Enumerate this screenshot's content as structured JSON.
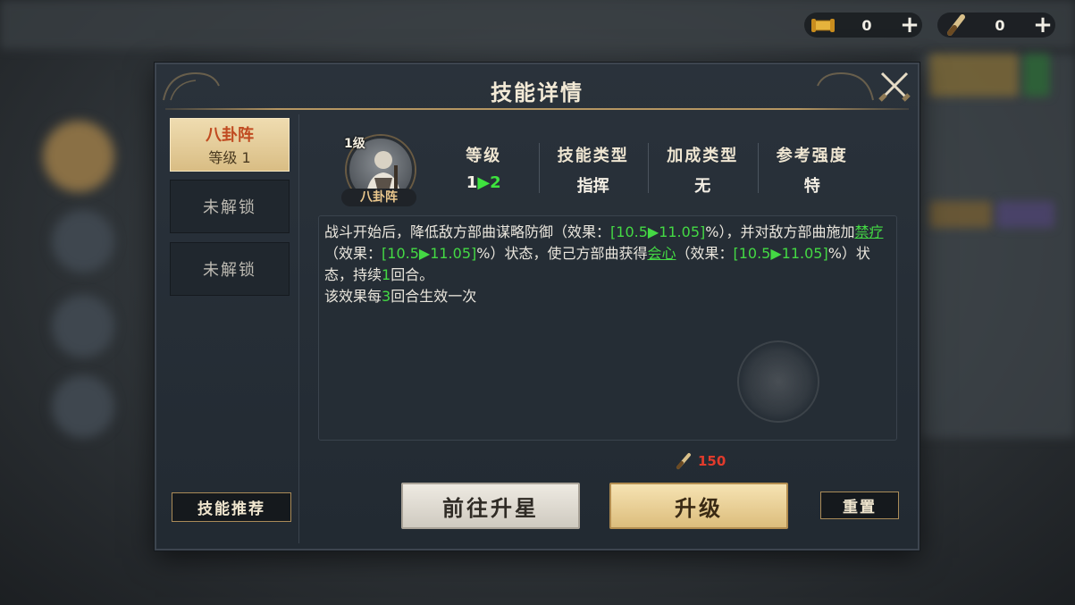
{
  "resources": [
    {
      "icon": "scroll-icon",
      "value": "0",
      "plus": "+"
    },
    {
      "icon": "brush-icon",
      "value": "0",
      "plus": "+"
    }
  ],
  "dialog": {
    "title": "技能详情",
    "close_icon": "close-icon"
  },
  "tabs": [
    {
      "name": "八卦阵",
      "level": "等级 1",
      "state": "active"
    },
    {
      "name": "未解锁",
      "state": "locked"
    },
    {
      "name": "未解锁",
      "state": "locked"
    }
  ],
  "recommend_label": "技能推荐",
  "skill": {
    "portrait_level": "1级",
    "portrait_name": "八卦阵",
    "stats": [
      {
        "label": "等级",
        "from": "1",
        "arrow": "▶",
        "to": "2"
      },
      {
        "label": "技能类型",
        "value": "指挥"
      },
      {
        "label": "加成类型",
        "value": "无"
      },
      {
        "label": "参考强度",
        "value": "特"
      }
    ]
  },
  "description": {
    "p1_a": "战斗开始后，降低敌方部曲谋略防御（效果：",
    "v1": "[10.5▶11.05]",
    "p1_b": "%），并对敌方部曲施加",
    "kw1": "禁疗",
    "p1_c": "（效果：",
    "v2": "[10.5▶11.05]",
    "p1_d": "%）状态，使己方部曲获得",
    "kw2": "会心",
    "p1_e": "（效果：",
    "v3": "[10.5▶11.05]",
    "p1_f": "%）状态，持续",
    "turns": "1",
    "p1_g": "回合。",
    "p2_a": "该效果每",
    "every": "3",
    "p2_b": "回合生效一次"
  },
  "cost": {
    "icon": "brush-icon",
    "amount": "150",
    "color": "#e23b2c"
  },
  "buttons": {
    "star": "前往升星",
    "upgrade": "升级",
    "reset": "重置"
  }
}
